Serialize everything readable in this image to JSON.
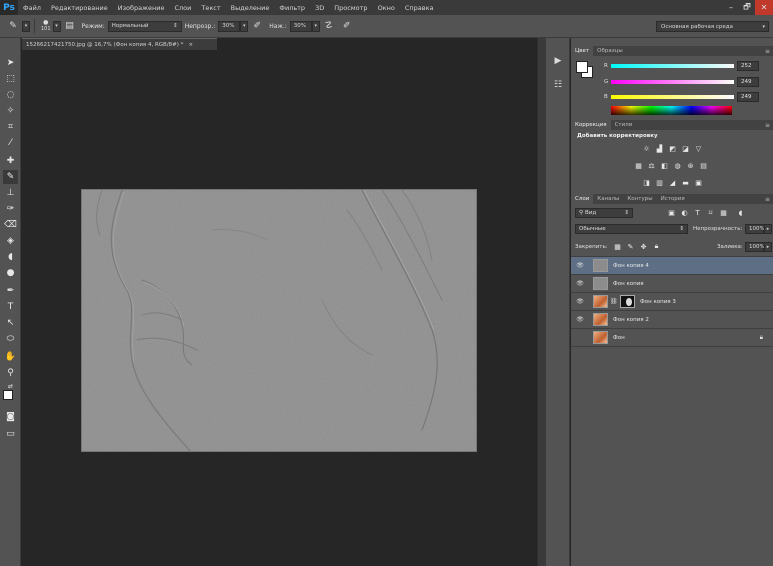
{
  "app": {
    "logo": "Ps"
  },
  "menu": [
    "Файл",
    "Редактирование",
    "Изображение",
    "Слои",
    "Текст",
    "Выделение",
    "Фильтр",
    "3D",
    "Просмотр",
    "Окно",
    "Справка"
  ],
  "window_controls": {
    "minimize": "–",
    "maximize": "🗗",
    "close": "✕"
  },
  "options": {
    "brush_size": "101",
    "mode_label": "Режим:",
    "mode_value": "Нормальный",
    "opacity_label": "Непрозр.:",
    "opacity_value": "30%",
    "flow_label": "Наж.:",
    "flow_value": "30%",
    "workspace": "Основная рабочая среда"
  },
  "document": {
    "tab_title": "15266217421750.jpg @ 16,7% (Фон копия 4, RGB/8#) *",
    "tab_close": "×"
  },
  "color_panel": {
    "tabs": [
      "Цвет",
      "Образцы"
    ],
    "r_label": "R",
    "r_value": "252",
    "g_label": "G",
    "g_value": "249",
    "b_label": "B",
    "b_value": "249"
  },
  "adjustments_panel": {
    "tabs": [
      "Коррекция",
      "Стили"
    ],
    "title": "Добавить корректировку"
  },
  "layers_panel": {
    "tabs": [
      "Слои",
      "Каналы",
      "Контуры",
      "История"
    ],
    "filter_label": "Вид",
    "blend_mode": "Обычные",
    "opacity_label": "Непрозрачность:",
    "opacity_value": "100%",
    "lock_label": "Закрепить:",
    "fill_label": "Заливка:",
    "fill_value": "100%",
    "layers": [
      {
        "name": "Фон копия 4",
        "thumb": "gray",
        "visible": true,
        "selected": true
      },
      {
        "name": "Фон копия",
        "thumb": "gray",
        "visible": true,
        "selected": false
      },
      {
        "name": "Фон копия 3",
        "thumb": "skin",
        "visible": true,
        "selected": false,
        "mask": true
      },
      {
        "name": "Фон копия 2",
        "thumb": "skin",
        "visible": true,
        "selected": false
      },
      {
        "name": "Фон",
        "thumb": "skin",
        "visible": false,
        "selected": false,
        "locked": true
      }
    ]
  },
  "colors": {
    "selected_layer": "#5d6e85",
    "ps_blue": "#31a8ff",
    "canvas_gray": "#8e8e8e"
  }
}
